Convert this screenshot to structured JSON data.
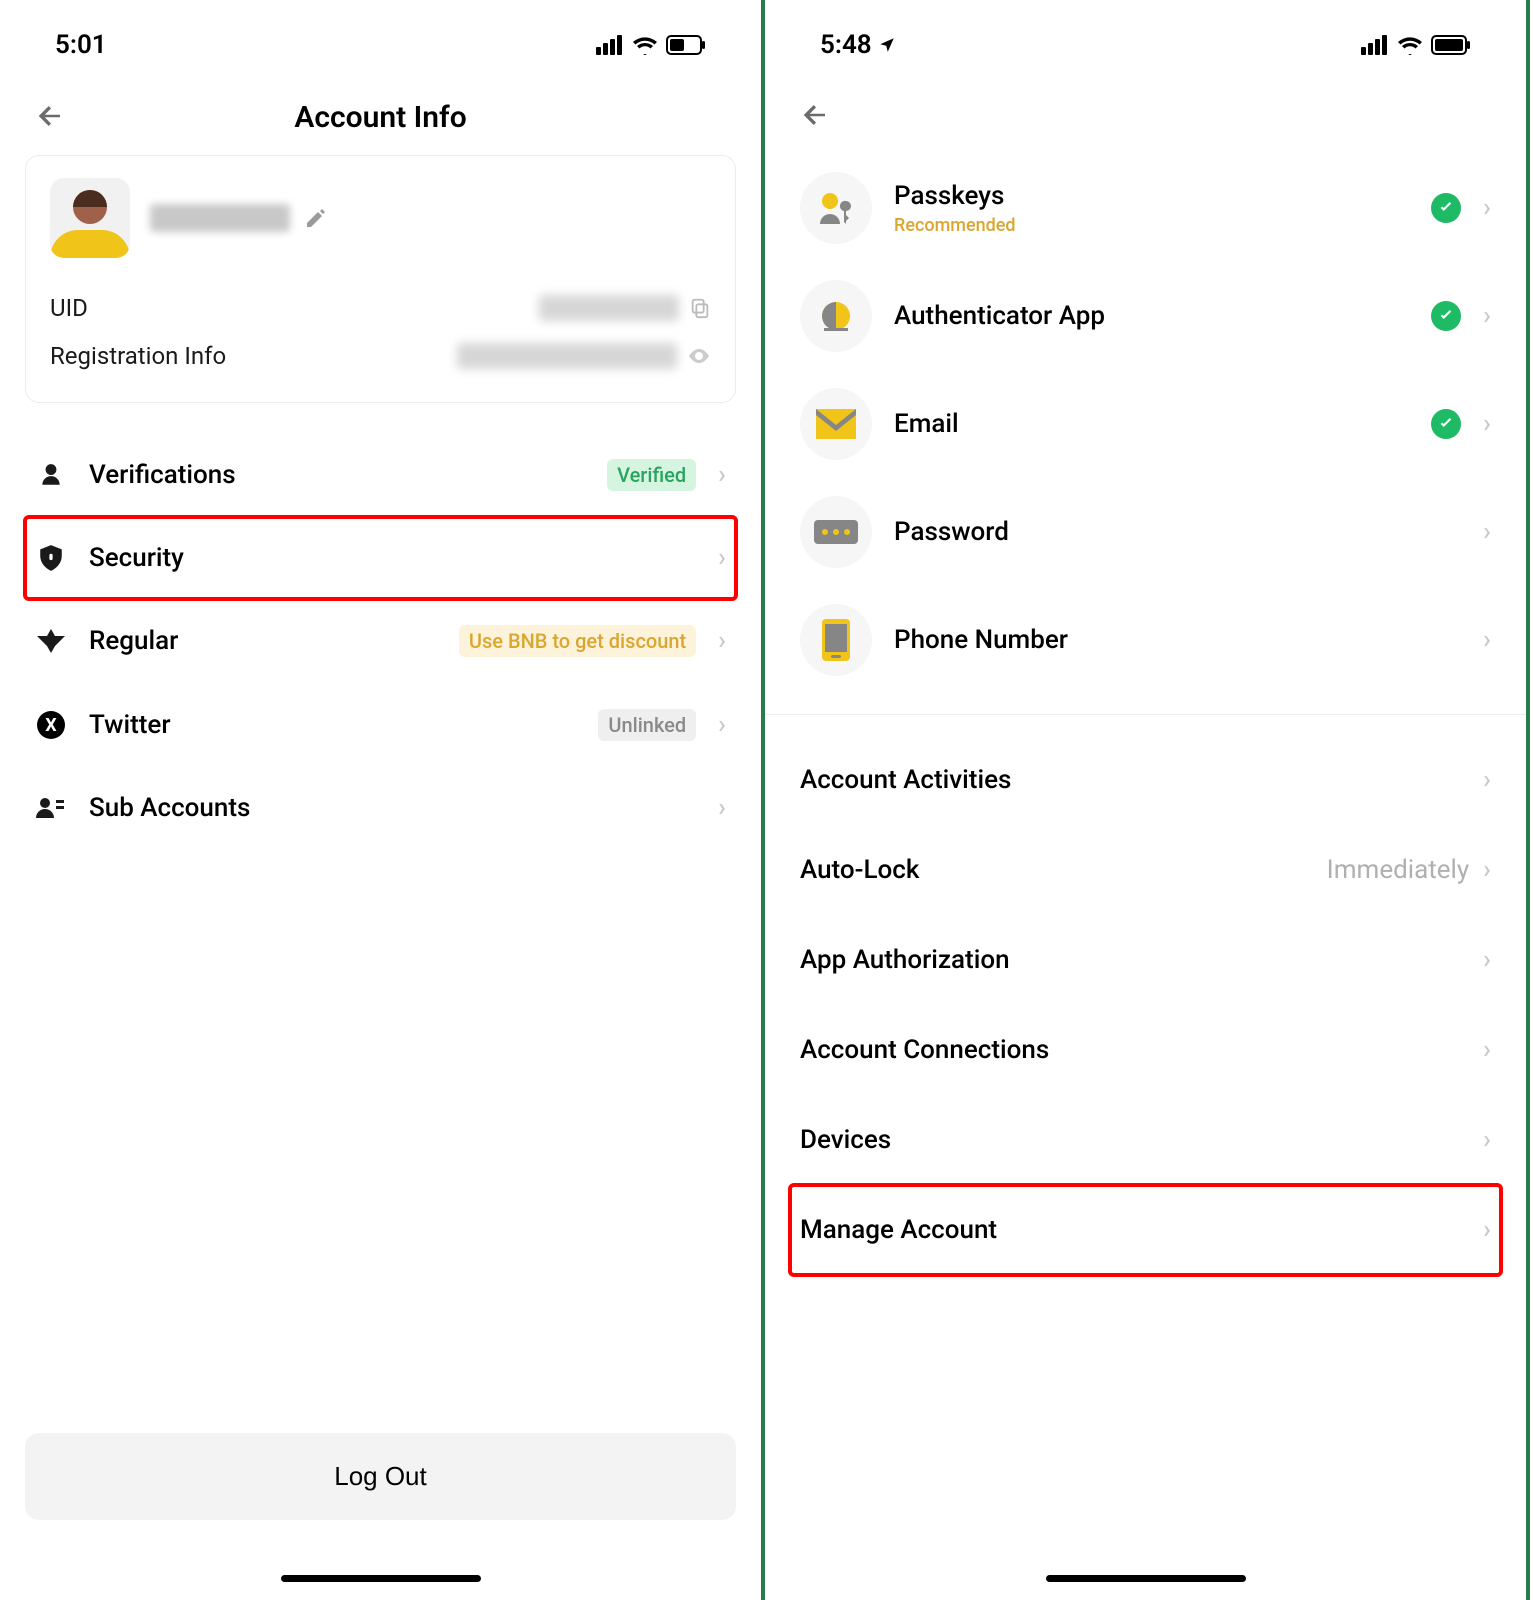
{
  "left": {
    "status_time": "5:01",
    "nav_title": "Account Info",
    "uid_label": "UID",
    "reg_label": "Registration Info",
    "items": [
      {
        "label": "Verifications",
        "badge": "Verified",
        "badge_cls": "badge-green"
      },
      {
        "label": "Security"
      },
      {
        "label": "Regular",
        "badge": "Use BNB to get discount",
        "badge_cls": "badge-yellow-soft"
      },
      {
        "label": "Twitter",
        "badge": "Unlinked",
        "badge_cls": "badge-gray"
      },
      {
        "label": "Sub Accounts"
      }
    ],
    "logout": "Log Out"
  },
  "right": {
    "status_time": "5:48",
    "sec_items": [
      {
        "label": "Passkeys",
        "sub": "Recommended",
        "check": true
      },
      {
        "label": "Authenticator App",
        "check": true
      },
      {
        "label": "Email",
        "check": true
      },
      {
        "label": "Password"
      },
      {
        "label": "Phone Number"
      }
    ],
    "simple": [
      {
        "label": "Account Activities"
      },
      {
        "label": "Auto-Lock",
        "value": "Immediately"
      },
      {
        "label": "App Authorization"
      },
      {
        "label": "Account Connections"
      },
      {
        "label": "Devices"
      },
      {
        "label": "Manage Account"
      }
    ]
  }
}
